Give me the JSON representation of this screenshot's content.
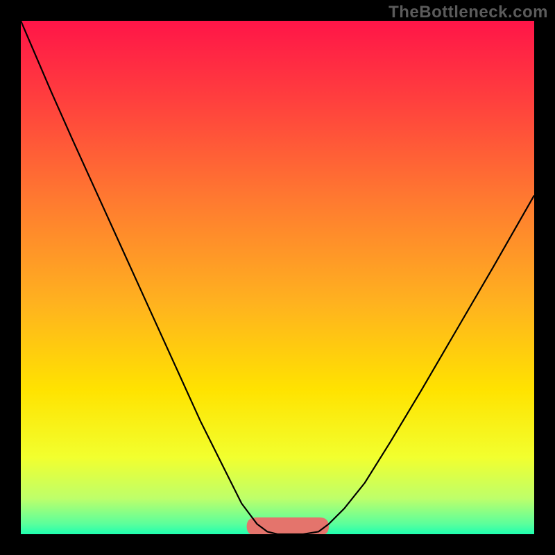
{
  "watermark": "TheBottleneck.com",
  "chart_data": {
    "type": "line",
    "title": "",
    "xlabel": "",
    "ylabel": "",
    "xlim": [
      0,
      100
    ],
    "ylim": [
      0,
      100
    ],
    "grid": false,
    "legend": false,
    "series": [
      {
        "name": "bottleneck-curve",
        "x": [
          0,
          3,
          6,
          10,
          15,
          20,
          25,
          30,
          35,
          40,
          43,
          46,
          48,
          50,
          52,
          55,
          58,
          60,
          63,
          67,
          72,
          78,
          85,
          92,
          100
        ],
        "y": [
          100,
          93,
          86,
          77,
          66,
          55,
          44,
          33,
          22,
          12,
          6,
          2,
          0.5,
          0,
          0,
          0,
          0.5,
          2,
          5,
          10,
          18,
          28,
          40,
          52,
          66
        ]
      }
    ],
    "highlight": {
      "name": "optimal-range",
      "x_range": [
        44,
        60
      ],
      "y_range": [
        0,
        3
      ],
      "color": "#e4746c"
    },
    "background_gradient": {
      "type": "vertical",
      "stops": [
        {
          "offset": 0.0,
          "color": "#ff1548"
        },
        {
          "offset": 0.15,
          "color": "#ff3e3e"
        },
        {
          "offset": 0.35,
          "color": "#ff7a30"
        },
        {
          "offset": 0.55,
          "color": "#ffb21f"
        },
        {
          "offset": 0.72,
          "color": "#ffe300"
        },
        {
          "offset": 0.85,
          "color": "#f2ff2e"
        },
        {
          "offset": 0.93,
          "color": "#beff6a"
        },
        {
          "offset": 0.98,
          "color": "#5bff9c"
        },
        {
          "offset": 1.0,
          "color": "#1fffb0"
        }
      ]
    }
  }
}
